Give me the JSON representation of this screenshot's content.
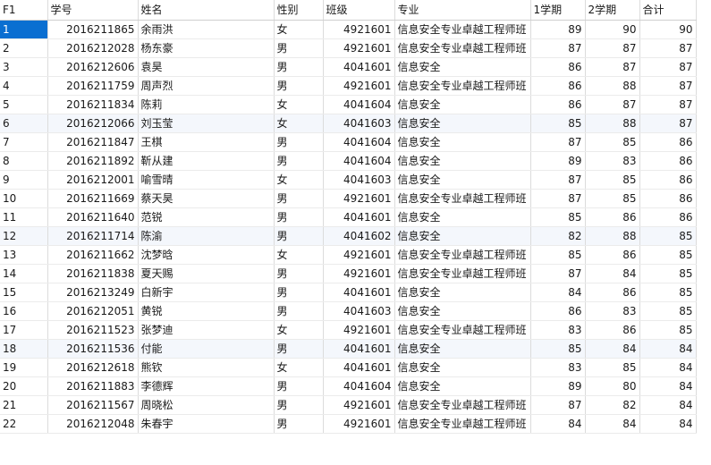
{
  "grid": {
    "columns": [
      "F1",
      "学号",
      "姓名",
      "性别",
      "班级",
      "专业",
      "1学期",
      "2学期",
      "合计"
    ],
    "rows": [
      [
        "1",
        "2016211865",
        "余雨洪",
        "女",
        "4921601",
        "信息安全专业卓越工程师班",
        "89",
        "90",
        "90"
      ],
      [
        "2",
        "2016212028",
        "杨东豪",
        "男",
        "4921601",
        "信息安全专业卓越工程师班",
        "87",
        "87",
        "87"
      ],
      [
        "3",
        "2016212606",
        "袁昊",
        "男",
        "4041601",
        "信息安全",
        "86",
        "87",
        "87"
      ],
      [
        "4",
        "2016211759",
        "周声烈",
        "男",
        "4921601",
        "信息安全专业卓越工程师班",
        "86",
        "88",
        "87"
      ],
      [
        "5",
        "2016211834",
        "陈莉",
        "女",
        "4041604",
        "信息安全",
        "86",
        "87",
        "87"
      ],
      [
        "6",
        "2016212066",
        "刘玉莹",
        "女",
        "4041603",
        "信息安全",
        "85",
        "88",
        "87"
      ],
      [
        "7",
        "2016211847",
        "王棋",
        "男",
        "4041604",
        "信息安全",
        "87",
        "85",
        "86"
      ],
      [
        "8",
        "2016211892",
        "靳从建",
        "男",
        "4041604",
        "信息安全",
        "89",
        "83",
        "86"
      ],
      [
        "9",
        "2016212001",
        "喻雪晴",
        "女",
        "4041603",
        "信息安全",
        "87",
        "85",
        "86"
      ],
      [
        "10",
        "2016211669",
        "蔡天昊",
        "男",
        "4921601",
        "信息安全专业卓越工程师班",
        "87",
        "85",
        "86"
      ],
      [
        "11",
        "2016211640",
        "范锐",
        "男",
        "4041601",
        "信息安全",
        "85",
        "86",
        "86"
      ],
      [
        "12",
        "2016211714",
        "陈渝",
        "男",
        "4041602",
        "信息安全",
        "82",
        "88",
        "85"
      ],
      [
        "13",
        "2016211662",
        "沈梦晗",
        "女",
        "4921601",
        "信息安全专业卓越工程师班",
        "85",
        "86",
        "85"
      ],
      [
        "14",
        "2016211838",
        "夏天赐",
        "男",
        "4921601",
        "信息安全专业卓越工程师班",
        "87",
        "84",
        "85"
      ],
      [
        "15",
        "2016213249",
        "白新宇",
        "男",
        "4041601",
        "信息安全",
        "84",
        "86",
        "85"
      ],
      [
        "16",
        "2016212051",
        "黄锐",
        "男",
        "4041603",
        "信息安全",
        "86",
        "83",
        "85"
      ],
      [
        "17",
        "2016211523",
        "张梦迪",
        "女",
        "4921601",
        "信息安全专业卓越工程师班",
        "83",
        "86",
        "85"
      ],
      [
        "18",
        "2016211536",
        "付能",
        "男",
        "4041601",
        "信息安全",
        "85",
        "84",
        "84"
      ],
      [
        "19",
        "2016212618",
        "熊钦",
        "女",
        "4041601",
        "信息安全",
        "83",
        "85",
        "84"
      ],
      [
        "20",
        "2016211883",
        "李德辉",
        "男",
        "4041604",
        "信息安全",
        "89",
        "80",
        "84"
      ],
      [
        "21",
        "2016211567",
        "周晓松",
        "男",
        "4921601",
        "信息安全专业卓越工程师班",
        "87",
        "82",
        "84"
      ],
      [
        "22",
        "2016212048",
        "朱春宇",
        "男",
        "4921601",
        "信息安全专业卓越工程师班",
        "84",
        "84",
        "84"
      ]
    ],
    "colors": {
      "selection": "#0a6fd1",
      "alt_row": "#f4f7fc",
      "grid_line": "#dcdcdc"
    }
  }
}
